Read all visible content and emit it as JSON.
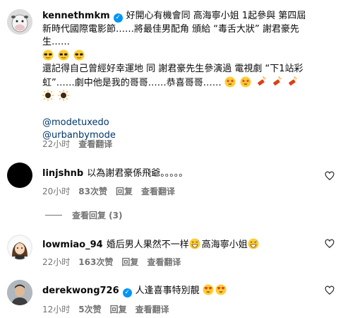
{
  "comments": [
    {
      "username": "kennethmkm",
      "verified": true,
      "text_line1": "好開心有機會同 高海寧小姐 1起參與 第四屆新時代國際電影節……將最佳男配角 頒給 “毒舌大狀” 謝君豪先生……",
      "text_line2": "還記得自己曾經好幸運地 同 謝君豪先生參演過 電視劇 “下1站彩虹”……劇中他是我的哥哥……恭喜哥哥……",
      "mentions": [
        "@modetuxedo",
        "@urbanbymode"
      ],
      "time": "22小时",
      "translate": "查看翻译"
    },
    {
      "username": "linjshnb",
      "verified": false,
      "text": "以為謝君豪係飛爺。。。。。",
      "time": "20小时",
      "likes": "83次赞",
      "reply": "回复",
      "translate": "查看翻译",
      "view_replies": "查看回复 (3)"
    },
    {
      "username": "lowmiao_94",
      "verified": false,
      "text_a": "婚后男人果然不一样",
      "text_b": "高海寧小姐",
      "time": "22小时",
      "likes": "163次赞",
      "reply": "回复",
      "translate": "查看翻译"
    },
    {
      "username": "derekwong726",
      "verified": true,
      "text": "人逢喜事特別靚",
      "time": "12小时",
      "likes": "5次赞",
      "reply": "回复",
      "translate": "查看翻译"
    }
  ],
  "icons": [
    "verified-badge-icon",
    "heart-icon",
    "sunglasses-emoji-icon",
    "star-struck-emoji-icon",
    "firecracker-emoji-icon",
    "grinning-sweat-emoji-icon",
    "heart-eyes-emoji-icon"
  ],
  "colors": {
    "link": "#00376b",
    "meta": "#737373",
    "verified": "#0095f6"
  }
}
